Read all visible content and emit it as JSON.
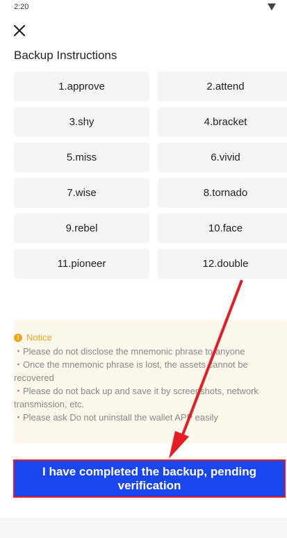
{
  "status": {
    "time": "2:20"
  },
  "header": {
    "title": "Backup Instructions"
  },
  "words": [
    "1.approve",
    "2.attend",
    "3.shy",
    "4.bracket",
    "5.miss",
    "6.vivid",
    "7.wise",
    "8.tornado",
    "9.rebel",
    "10.face",
    "11.pioneer",
    "12.double"
  ],
  "notice": {
    "title": "Notice",
    "lines": [
      "・Please do not disclose the mnemonic phrase to anyone",
      "・Once the mnemonic phrase is lost, the assets cannot be recovered",
      "・Please do not back up and save it by screenshots, network transmission, etc.",
      "・Please ask Do not uninstall the wallet APP easily"
    ]
  },
  "actions": {
    "confirm_label": "I have completed the backup, pending verification"
  },
  "colors": {
    "accent": "#1a46f0",
    "notice": "#f2a31b",
    "highlight": "#e51c23"
  }
}
